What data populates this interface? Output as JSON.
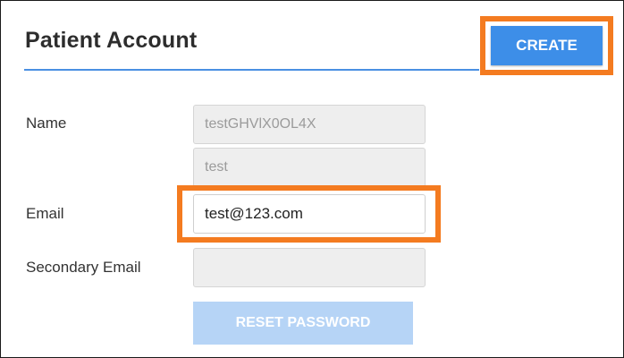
{
  "header": {
    "title": "Patient Account",
    "create_label": "CREATE"
  },
  "form": {
    "name_label": "Name",
    "first_name_value": "testGHVlX0OL4X",
    "last_name_value": "test",
    "email_label": "Email",
    "email_value": "test@123.com",
    "secondary_email_label": "Secondary Email",
    "secondary_email_value": "",
    "reset_password_label": "RESET PASSWORD"
  },
  "colors": {
    "accent": "#3d8ee8",
    "highlight": "#f47b20",
    "disabled_button": "#b6d4f6"
  }
}
